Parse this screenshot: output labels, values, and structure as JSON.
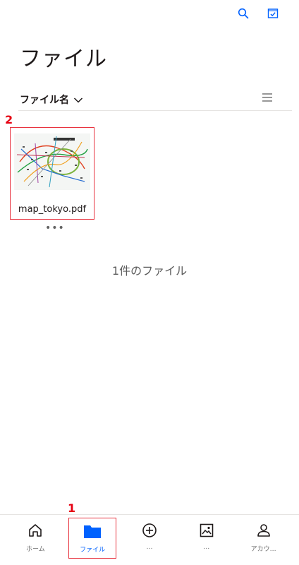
{
  "top_actions": [
    {
      "icon": "search-icon",
      "color": "#0061fe"
    },
    {
      "icon": "select-checkbox-icon",
      "color": "#0061fe"
    }
  ],
  "page": {
    "title": "ファイル"
  },
  "sort": {
    "label": "ファイル名",
    "chevron_icon": "chevron-down-icon",
    "view_icon": "list-view-icon"
  },
  "annotations": {
    "file_card": "2",
    "files_tab": "1"
  },
  "files": [
    {
      "name": "map_tokyo.pdf",
      "thumbnail": "tokyo-rail-map-thumbnail",
      "more": "•••"
    }
  ],
  "footer": {
    "count_text": "1件のファイル"
  },
  "bottom_nav": {
    "accent_color": "#0061fe",
    "items": [
      {
        "icon": "home-icon",
        "label": "ホーム"
      },
      {
        "icon": "folder-icon",
        "label": "ファイル",
        "active": true
      },
      {
        "icon": "add-circle-icon",
        "label": "…"
      },
      {
        "icon": "photos-icon",
        "label": "…"
      },
      {
        "icon": "account-icon",
        "label": "アカウ…"
      }
    ]
  }
}
